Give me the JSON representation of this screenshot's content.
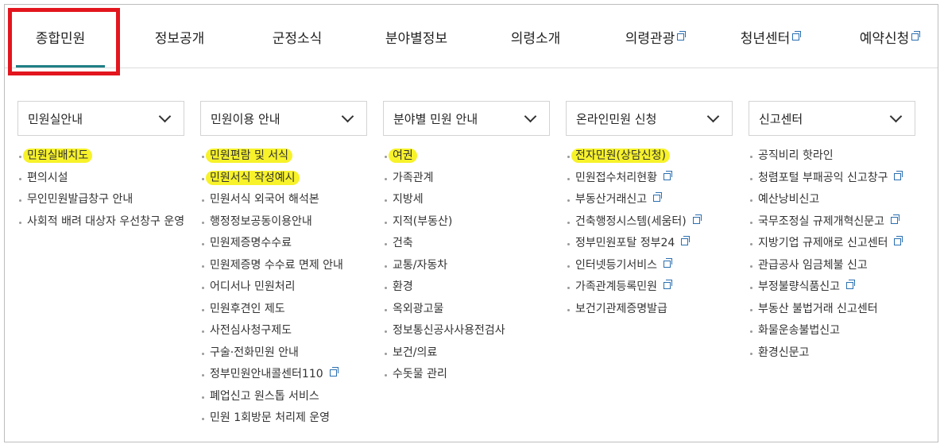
{
  "gnb": [
    {
      "label": "종합민원",
      "active": true,
      "external": false
    },
    {
      "label": "정보공개",
      "active": false,
      "external": false
    },
    {
      "label": "군정소식",
      "active": false,
      "external": false
    },
    {
      "label": "분야별정보",
      "active": false,
      "external": false
    },
    {
      "label": "의령소개",
      "active": false,
      "external": false
    },
    {
      "label": "의령관광",
      "active": false,
      "external": true
    },
    {
      "label": "청년센터",
      "active": false,
      "external": true
    },
    {
      "label": "예약신청",
      "active": false,
      "external": true
    }
  ],
  "columns": [
    {
      "title": "민원실안내",
      "items": [
        {
          "label": "민원실배치도",
          "highlight": true,
          "external": false
        },
        {
          "label": "편의시설",
          "highlight": false,
          "external": false
        },
        {
          "label": "무인민원발급창구 안내",
          "highlight": false,
          "external": false
        },
        {
          "label": "사회적 배려 대상자 우선창구 운영",
          "highlight": false,
          "external": false
        }
      ]
    },
    {
      "title": "민원이용 안내",
      "items": [
        {
          "label": "민원편람 및 서식",
          "highlight": true,
          "external": false
        },
        {
          "label": "민원서식 작성예시",
          "highlight": true,
          "external": false
        },
        {
          "label": "민원서식 외국어 해석본",
          "highlight": false,
          "external": false
        },
        {
          "label": "행정정보공동이용안내",
          "highlight": false,
          "external": false
        },
        {
          "label": "민원제증명수수료",
          "highlight": false,
          "external": false
        },
        {
          "label": "민원제증명 수수료 면제 안내",
          "highlight": false,
          "external": false
        },
        {
          "label": "어디서나 민원처리",
          "highlight": false,
          "external": false
        },
        {
          "label": "민원후견인 제도",
          "highlight": false,
          "external": false
        },
        {
          "label": "사전심사청구제도",
          "highlight": false,
          "external": false
        },
        {
          "label": "구술·전화민원 안내",
          "highlight": false,
          "external": false
        },
        {
          "label": "정부민원안내콜센터110",
          "highlight": false,
          "external": true
        },
        {
          "label": "폐업신고 원스톱 서비스",
          "highlight": false,
          "external": false
        },
        {
          "label": "민원 1회방문 처리제 운영",
          "highlight": false,
          "external": false
        }
      ]
    },
    {
      "title": "분야별 민원 안내",
      "items": [
        {
          "label": "여권",
          "highlight": true,
          "external": false
        },
        {
          "label": "가족관계",
          "highlight": false,
          "external": false
        },
        {
          "label": "지방세",
          "highlight": false,
          "external": false
        },
        {
          "label": "지적(부동산)",
          "highlight": false,
          "external": false
        },
        {
          "label": "건축",
          "highlight": false,
          "external": false
        },
        {
          "label": "교통/자동차",
          "highlight": false,
          "external": false
        },
        {
          "label": "환경",
          "highlight": false,
          "external": false
        },
        {
          "label": "옥외광고물",
          "highlight": false,
          "external": false
        },
        {
          "label": "정보통신공사사용전검사",
          "highlight": false,
          "external": false
        },
        {
          "label": "보건/의료",
          "highlight": false,
          "external": false
        },
        {
          "label": "수돗물 관리",
          "highlight": false,
          "external": false
        }
      ]
    },
    {
      "title": "온라인민원 신청",
      "items": [
        {
          "label": "전자민원(상담신청)",
          "highlight": true,
          "external": false
        },
        {
          "label": "민원접수처리현황",
          "highlight": false,
          "external": true
        },
        {
          "label": "부동산거래신고",
          "highlight": false,
          "external": true
        },
        {
          "label": "건축행정시스템(세움터)",
          "highlight": false,
          "external": true
        },
        {
          "label": "정부민원포탈 정부24",
          "highlight": false,
          "external": true
        },
        {
          "label": "인터넷등기서비스",
          "highlight": false,
          "external": true
        },
        {
          "label": "가족관계등록민원",
          "highlight": false,
          "external": true
        },
        {
          "label": "보건기관제증명발급",
          "highlight": false,
          "external": false
        }
      ]
    },
    {
      "title": "신고센터",
      "items": [
        {
          "label": "공직비리 핫라인",
          "highlight": false,
          "external": false
        },
        {
          "label": "청렴포털 부패공익 신고창구",
          "highlight": false,
          "external": true
        },
        {
          "label": "예산낭비신고",
          "highlight": false,
          "external": false
        },
        {
          "label": "국무조정실 규제개혁신문고",
          "highlight": false,
          "external": true
        },
        {
          "label": "지방기업 규제애로 신고센터",
          "highlight": false,
          "external": true
        },
        {
          "label": "관급공사 임금체불 신고",
          "highlight": false,
          "external": false
        },
        {
          "label": "부정불량식품신고",
          "highlight": false,
          "external": true
        },
        {
          "label": "부동산 불법거래 신고센터",
          "highlight": false,
          "external": false
        },
        {
          "label": "화물운송불법신고",
          "highlight": false,
          "external": false
        },
        {
          "label": "환경신문고",
          "highlight": false,
          "external": false
        }
      ]
    }
  ]
}
